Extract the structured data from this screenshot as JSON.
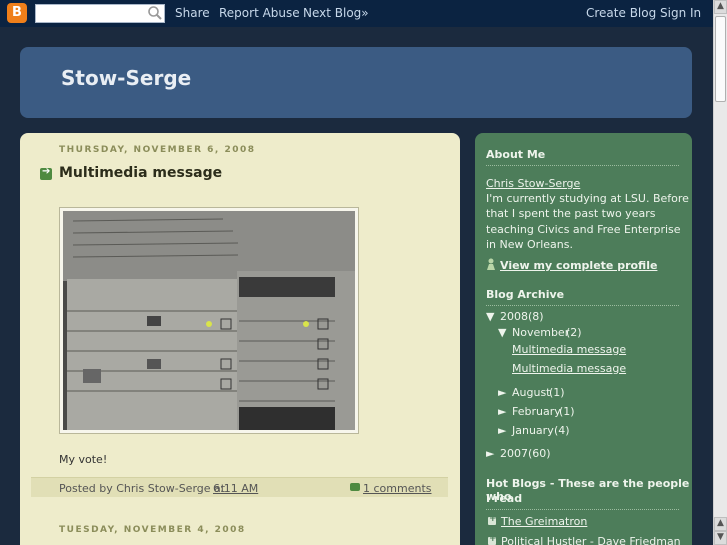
{
  "navbar": {
    "logo": "B",
    "search_value": "",
    "share": "Share",
    "report_abuse": "Report Abuse",
    "next_blog": "Next Blog»",
    "create_blog": "Create Blog",
    "sign_in": "Sign In"
  },
  "header": {
    "title": "Stow-Serge"
  },
  "posts": [
    {
      "date": "THURSDAY, NOVEMBER 6, 2008",
      "title": "Multimedia message",
      "body": "My vote!",
      "footer_prefix": "Posted by Chris Stow-Serge at",
      "time": "6:11 AM",
      "comments": "1 comments"
    },
    {
      "date": "TUESDAY, NOVEMBER 4, 2008"
    }
  ],
  "sidebar": {
    "about_heading": "About Me",
    "author_name": "Chris Stow-Serge",
    "about_lines": [
      "I'm currently studying at LSU. Before",
      "that I spent the past two years",
      "teaching Civics and Free Enterprise",
      "in New Orleans."
    ],
    "profile_link": "View my complete profile",
    "archive_heading": "Blog Archive",
    "archive": {
      "y2008": "2008",
      "y2008_count": "(8)",
      "november": "November",
      "november_count": "(2)",
      "nov_posts": [
        "Multimedia message",
        "Multimedia message"
      ],
      "august": "August",
      "august_count": "(1)",
      "february": "February",
      "february_count": "(1)",
      "january": "January",
      "january_count": "(4)",
      "y2007": "2007",
      "y2007_count": "(60)"
    },
    "hot_heading_lines": [
      "Hot Blogs - These are the people who",
      "I read"
    ],
    "hot_blogs": [
      "The Greimatron",
      "Political Hustler - Dave Friedman"
    ]
  },
  "colors": {
    "navbar": "#0b2341",
    "header": "#3b5b83",
    "main": "#eeeccb",
    "sidebar": "#4d7d5a",
    "link": "#1f3e99"
  },
  "icons": [
    "blogger-logo-icon",
    "search-icon",
    "post-arrow-icon",
    "comment-icon",
    "profile-icon",
    "expand-triangle-icon",
    "collapse-triangle-icon",
    "list-bullet-icon"
  ]
}
